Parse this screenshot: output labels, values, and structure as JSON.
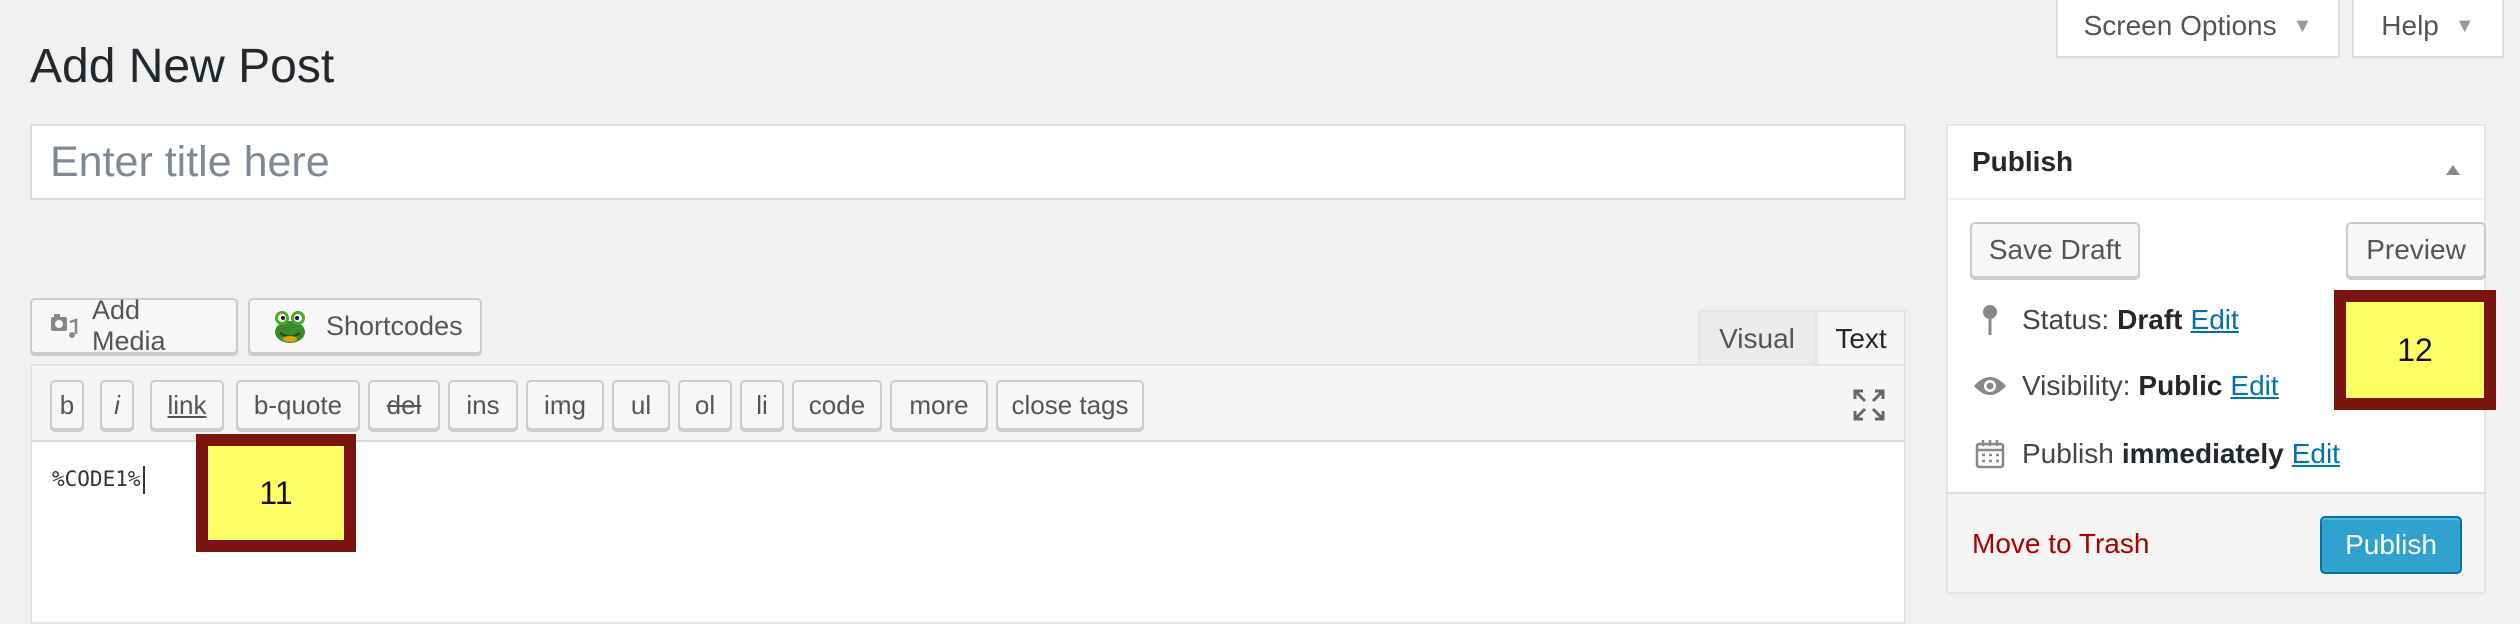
{
  "screen_meta": {
    "screen_options_label": "Screen Options",
    "help_label": "Help"
  },
  "page": {
    "title": "Add New Post"
  },
  "post_title": {
    "value": "",
    "placeholder": "Enter title here"
  },
  "media_buttons": {
    "add_media_label": "Add Media",
    "shortcodes_label": "Shortcodes"
  },
  "editor_tabs": {
    "visual_label": "Visual",
    "text_label": "Text",
    "active": "text"
  },
  "quicktags": [
    {
      "label": "b"
    },
    {
      "label": "i"
    },
    {
      "label": "link"
    },
    {
      "label": "b-quote"
    },
    {
      "label": "del"
    },
    {
      "label": "ins"
    },
    {
      "label": "img"
    },
    {
      "label": "ul"
    },
    {
      "label": "ol"
    },
    {
      "label": "li"
    },
    {
      "label": "code"
    },
    {
      "label": "more"
    },
    {
      "label": "close tags"
    }
  ],
  "editor": {
    "content": "%CODE1%"
  },
  "markers": {
    "m11": "11",
    "m12": "12"
  },
  "publish_box": {
    "heading": "Publish",
    "save_draft_label": "Save Draft",
    "preview_label": "Preview",
    "status_label": "Status:",
    "status_value": "Draft",
    "visibility_label": "Visibility:",
    "visibility_value": "Public",
    "schedule_label": "Publish",
    "schedule_value": "immediately",
    "edit_label": "Edit",
    "trash_label": "Move to Trash",
    "publish_label": "Publish"
  },
  "colors": {
    "primary_button": "#2ea2cc",
    "link": "#0073aa",
    "trash": "#aa0000",
    "marker_fill": "#ffff66",
    "marker_border": "#7b1410"
  },
  "icons": {
    "screen_options": "triangle-down-icon",
    "help": "triangle-down-icon",
    "add_media": "camera-music-icon",
    "shortcodes": "frog-icon",
    "fullscreen": "expand-arrows-icon",
    "status": "pin-icon",
    "visibility": "eye-icon",
    "schedule": "calendar-icon",
    "collapse": "triangle-up-icon"
  }
}
